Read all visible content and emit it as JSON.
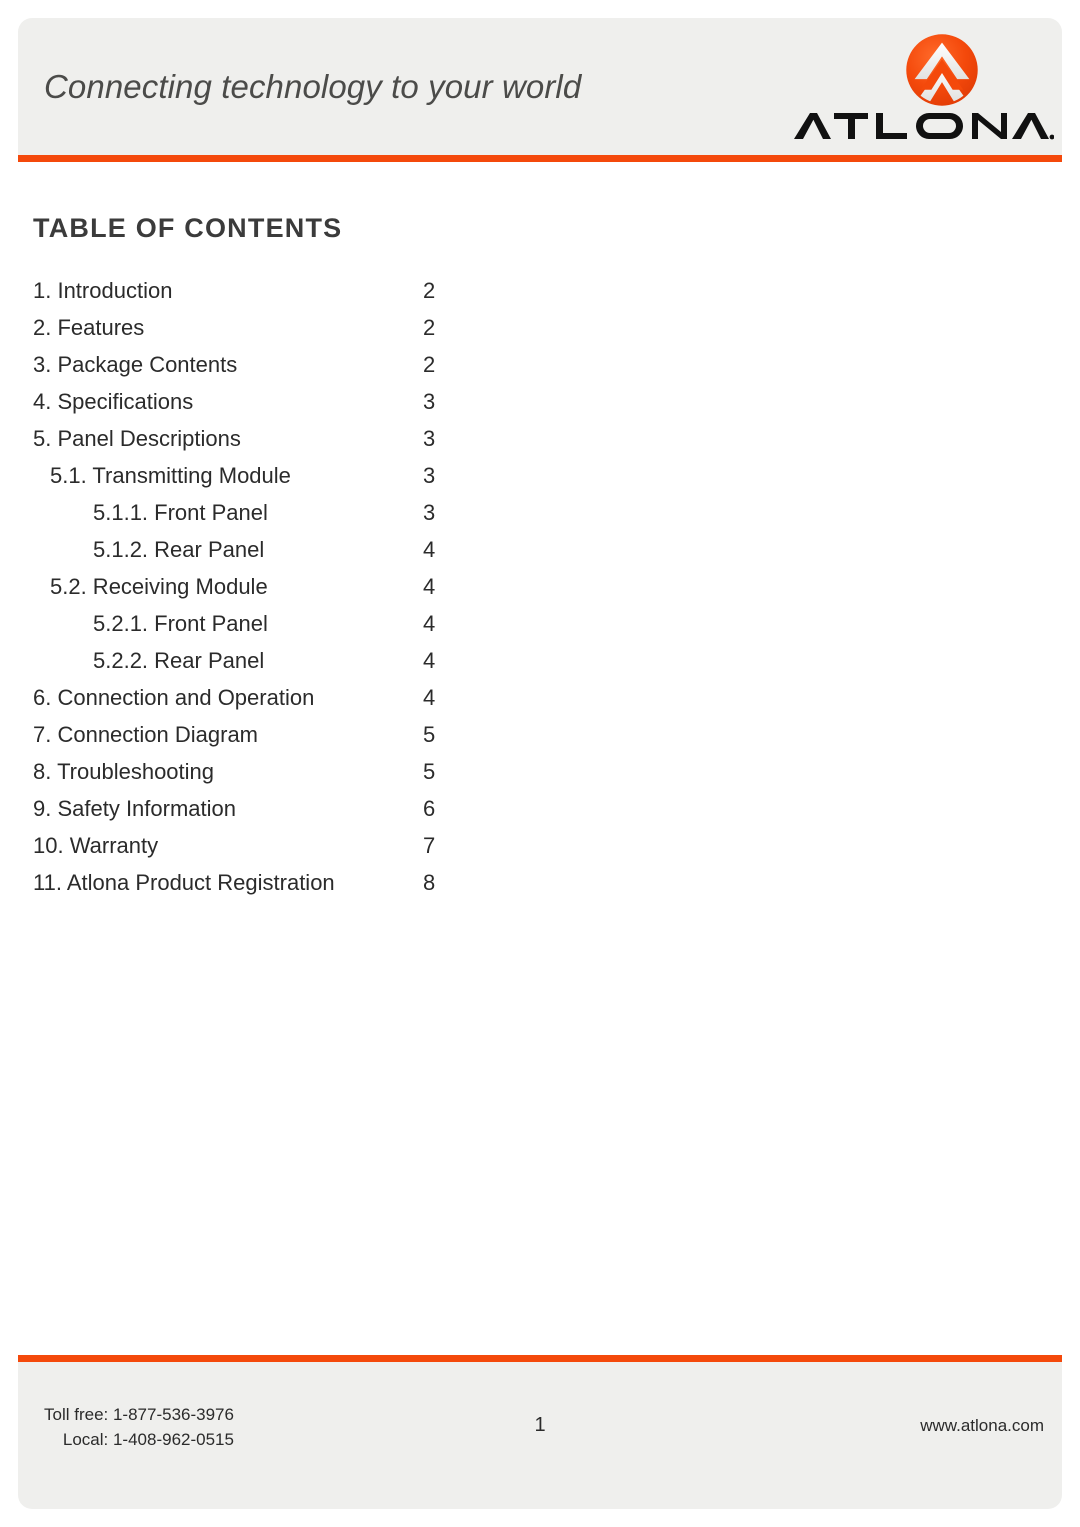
{
  "header": {
    "tagline": "Connecting technology to your world",
    "logo_wordmark": "ATLONA.",
    "accent_color": "#f4490b",
    "band_color": "#efefed"
  },
  "main": {
    "title": "TABLE OF CONTENTS",
    "entries": [
      {
        "label": "1. Introduction",
        "page": "2",
        "level": 1
      },
      {
        "label": "2. Features",
        "page": "2",
        "level": 1
      },
      {
        "label": "3. Package Contents",
        "page": "2",
        "level": 1
      },
      {
        "label": "4. Specifications",
        "page": "3",
        "level": 1
      },
      {
        "label": "5. Panel Descriptions",
        "page": "3",
        "level": 1
      },
      {
        "label": "5.1. Transmitting Module",
        "page": "3",
        "level": 2
      },
      {
        "label": "5.1.1. Front Panel",
        "page": "3",
        "level": 3
      },
      {
        "label": "5.1.2. Rear Panel",
        "page": "4",
        "level": 3
      },
      {
        "label": "5.2. Receiving Module",
        "page": "4",
        "level": 2
      },
      {
        "label": "5.2.1. Front Panel",
        "page": "4",
        "level": 3
      },
      {
        "label": "5.2.2. Rear Panel",
        "page": "4",
        "level": 3
      },
      {
        "label": "6. Connection and Operation",
        "page": "4",
        "level": 1
      },
      {
        "label": "7. Connection Diagram",
        "page": "5",
        "level": 1
      },
      {
        "label": "8. Troubleshooting",
        "page": "5",
        "level": 1
      },
      {
        "label": "9. Safety Information",
        "page": "6",
        "level": 1
      },
      {
        "label": "10. Warranty",
        "page": "7",
        "level": 1
      },
      {
        "label": "11. Atlona Product Registration",
        "page": "8",
        "level": 1
      }
    ]
  },
  "footer": {
    "toll_free": "Toll free: 1-877-536-3976",
    "local": "Local: 1-408-962-0515",
    "page_number": "1",
    "website": "www.atlona.com"
  }
}
